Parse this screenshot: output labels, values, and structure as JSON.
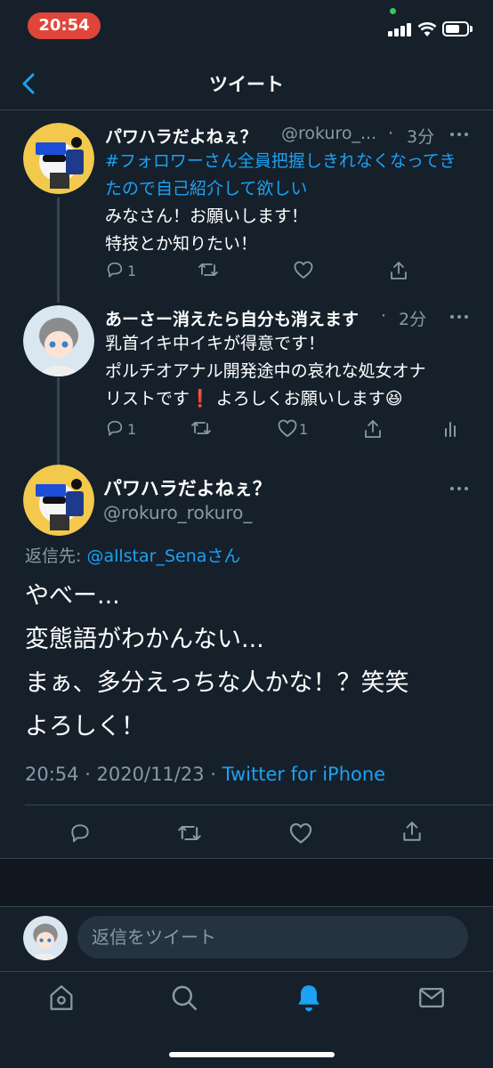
{
  "status_bar": {
    "time": "20:54"
  },
  "header": {
    "title": "ツイート"
  },
  "thread": [
    {
      "name": "パワハラだよねぇ？",
      "handle": "@rokuro_...",
      "time": "3分",
      "hashtag": "#フォロワーさん全員把握しきれなくなってきたので自己紹介して欲しい",
      "lines": [
        "みなさん！お願いします！",
        "特技とか知りたい！"
      ],
      "reply_count": "1",
      "retweet_count": "",
      "like_count": ""
    },
    {
      "name": "あーさー消えたら自分も消えます",
      "time": "2分",
      "lines": [
        "乳首イキ中イキが得意です！",
        "ポルチオアナル開発途中の哀れな処女オナ",
        "リストです❗ よろしくお願いします😆"
      ],
      "reply_count": "1",
      "retweet_count": "",
      "like_count": "1"
    }
  ],
  "main_tweet": {
    "name": "パワハラだよねぇ？",
    "handle": "@rokuro_rokuro_",
    "reply_to_label": "返信先: ",
    "reply_to_user": "@allstar_Senaさん",
    "lines": [
      "やべー...",
      "変態語がわかんない...",
      "まぁ、多分えっちな人かな！？笑笑",
      "よろしく！"
    ],
    "timestamp": "20:54 · 2020/11/23 · ",
    "source": "Twitter for iPhone"
  },
  "reply_bar": {
    "placeholder": "返信をツイート"
  },
  "colors": {
    "background": "#15202b",
    "accent": "#1da1f2",
    "muted": "#8899a6",
    "divider": "#38444d",
    "status_time_bg": "#e0453a"
  },
  "icons": [
    "back-chevron-icon",
    "more-icon",
    "reply-icon",
    "retweet-icon",
    "like-icon",
    "share-icon",
    "analytics-icon",
    "home-icon",
    "search-icon",
    "notifications-icon",
    "messages-icon"
  ]
}
